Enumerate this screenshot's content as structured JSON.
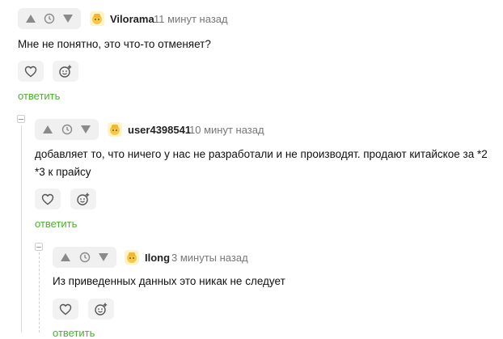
{
  "comments": [
    {
      "user": "Vilorama",
      "time": "11 минут назад",
      "text": "Мне не понятно, это что-то отменяет?",
      "reply": "ответить"
    },
    {
      "user": "user4398541",
      "time": "10 минут назад",
      "text": "добавляет то, что ничего у нас не разработали и не производят. продают китайское за *2 *3 к прайсу",
      "reply": "ответить"
    },
    {
      "user": "Ilong",
      "time": "3 минуты назад",
      "text": "Из приведенных данных это никак не следует",
      "reply": "ответить"
    }
  ],
  "icons": {
    "upvote": "triangle-up-icon",
    "downvote": "triangle-down-icon",
    "history": "clock-icon",
    "like": "heart-icon",
    "reaction": "add-emoji-icon",
    "avatar": "user-avatar"
  },
  "colors": {
    "reply_link": "#4caf2f",
    "vote_bg": "#f0f0f0",
    "meta_text": "#777777"
  }
}
